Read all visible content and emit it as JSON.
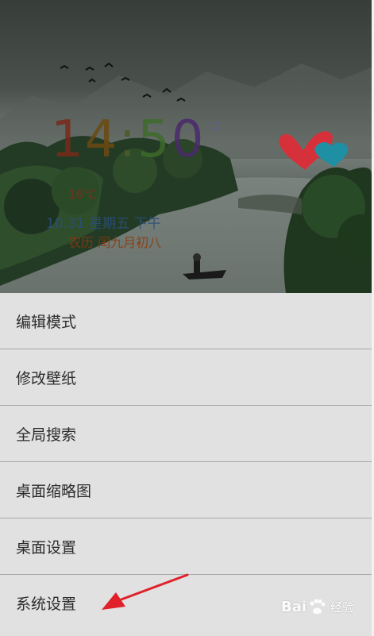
{
  "clock": {
    "d1": "1",
    "d2": "4",
    "colon": ":",
    "d3": "5",
    "d4": "0",
    "seconds": "12",
    "weather": "16℃",
    "date": "10.31 星期五 下午",
    "lunar": "农历 闰九月初八"
  },
  "menu": {
    "items": [
      {
        "label": "编辑模式"
      },
      {
        "label": "修改壁纸"
      },
      {
        "label": "全局搜索"
      },
      {
        "label": "桌面缩略图"
      },
      {
        "label": "桌面设置"
      },
      {
        "label": "系统设置"
      }
    ]
  },
  "watermark": {
    "brand_left": "Bai",
    "brand_right": "",
    "suffix": "经验"
  },
  "colors": {
    "menu_bg": "#e1e1e1",
    "divider": "#a8a8a8",
    "arrow": "#e0202a",
    "heart_red": "#d6313b",
    "heart_teal": "#1f8fa4"
  }
}
